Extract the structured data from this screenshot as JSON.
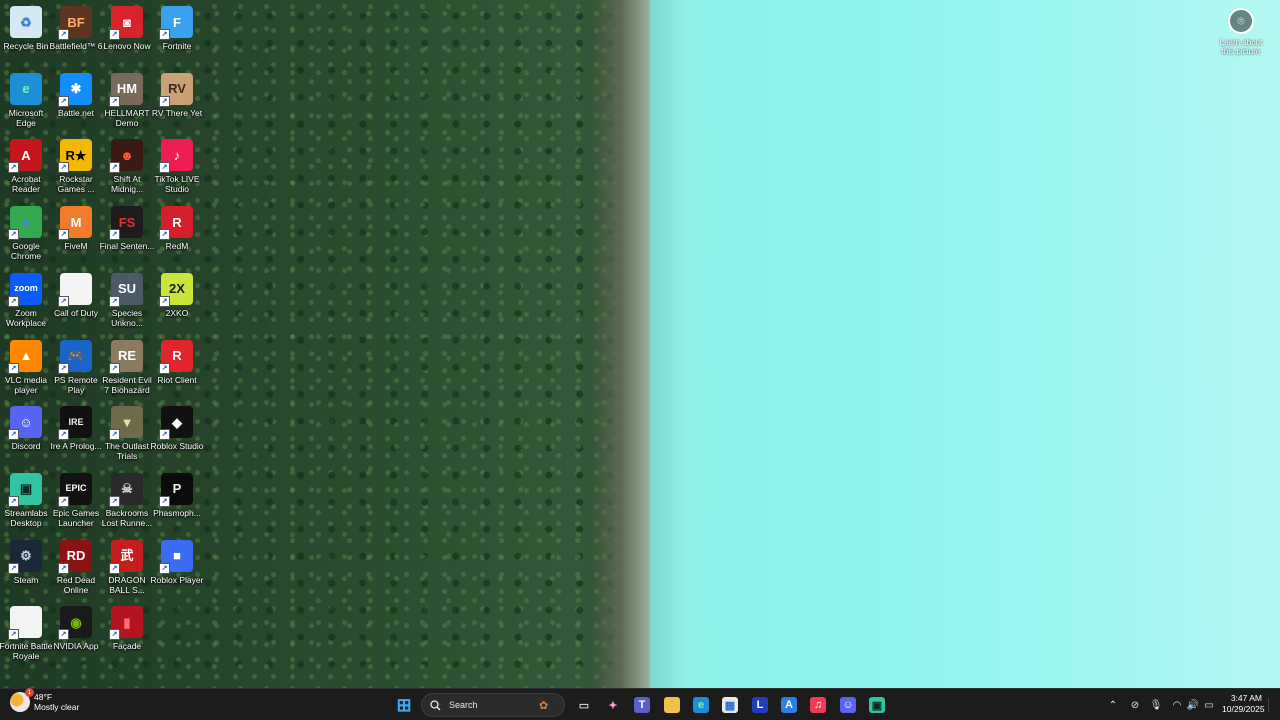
{
  "desktop": {
    "icons": [
      {
        "label": "Recycle Bin",
        "glyph": "♻",
        "color": "#d7e8f5",
        "text_color": "#3a7fd0",
        "icon": "recycle-bin-icon"
      },
      {
        "label": "Battlefield™ 6",
        "glyph": "BF",
        "color": "#5c3521",
        "text_color": "#ffb066",
        "icon": "battlefield-icon"
      },
      {
        "label": "Lenovo Now",
        "glyph": "◙",
        "color": "#d8232a",
        "text_color": "#ffffff",
        "icon": "lenovo-icon"
      },
      {
        "label": "Fortnite",
        "glyph": "F",
        "color": "#3aa0f0",
        "text_color": "#ffffff",
        "icon": "fortnite-icon"
      },
      {
        "label": "Microsoft Edge",
        "glyph": "e",
        "color": "#1d8fd6",
        "text_color": "#7df2a4",
        "icon": "edge-icon"
      },
      {
        "label": "Battle.net",
        "glyph": "✱",
        "color": "#148eff",
        "text_color": "#ffffff",
        "icon": "battlenet-icon"
      },
      {
        "label": "HELLMART Demo",
        "glyph": "HM",
        "color": "#7a6a5a",
        "text_color": "#ffffff",
        "icon": "hellmart-icon"
      },
      {
        "label": "RV There Yet",
        "glyph": "RV",
        "color": "#c9a278",
        "text_color": "#3a2a1a",
        "icon": "rv-there-yet-icon"
      },
      {
        "label": "Acrobat Reader",
        "glyph": "A",
        "color": "#c4161c",
        "text_color": "#ffffff",
        "icon": "acrobat-icon"
      },
      {
        "label": "Rockstar Games ...",
        "glyph": "R★",
        "color": "#f5b800",
        "text_color": "#000000",
        "icon": "rockstar-icon"
      },
      {
        "label": "Shift At Midnig...",
        "glyph": "☻",
        "color": "#3b1a14",
        "text_color": "#ff5a3a",
        "icon": "shift-at-midnight-icon"
      },
      {
        "label": "TikTok LIVE Studio",
        "glyph": "♪",
        "color": "#ee1d52",
        "text_color": "#ffffff",
        "icon": "tiktok-icon"
      },
      {
        "label": "Google Chrome",
        "glyph": "●",
        "color": "#34a853",
        "text_color": "#4285f4",
        "icon": "chrome-icon"
      },
      {
        "label": "FiveM",
        "glyph": "M",
        "color": "#f07b2b",
        "text_color": "#ffffff",
        "icon": "fivem-icon"
      },
      {
        "label": "Final Senten...",
        "glyph": "FS",
        "color": "#1c1c1c",
        "text_color": "#e03030",
        "icon": "final-sentence-icon"
      },
      {
        "label": "RedM",
        "glyph": "R",
        "color": "#d4202a",
        "text_color": "#ffffff",
        "icon": "redm-icon"
      },
      {
        "label": "Zoom Workplace",
        "glyph": "zoom",
        "color": "#0b5cff",
        "text_color": "#ffffff",
        "icon": "zoom-icon"
      },
      {
        "label": "Call of Duty",
        "glyph": "",
        "color": "#f4f4f4",
        "text_color": "#000000",
        "icon": "call-of-duty-icon"
      },
      {
        "label": "Species Unkno...",
        "glyph": "SU",
        "color": "#4a5a66",
        "text_color": "#ffffff",
        "icon": "species-unknown-icon"
      },
      {
        "label": "2XKO",
        "glyph": "2X",
        "color": "#c8e63a",
        "text_color": "#1a1a1a",
        "icon": "2xko-icon"
      },
      {
        "label": "VLC media player",
        "glyph": "▲",
        "color": "#ff8800",
        "text_color": "#ffffff",
        "icon": "vlc-icon"
      },
      {
        "label": "PS Remote Play",
        "glyph": "🎮",
        "color": "#1a63c7",
        "text_color": "#ffffff",
        "icon": "ps-remote-play-icon"
      },
      {
        "label": "Resident Evil 7 Biohazard",
        "glyph": "RE",
        "color": "#8a7a60",
        "text_color": "#ffffff",
        "icon": "resident-evil-icon"
      },
      {
        "label": "Riot Client",
        "glyph": "R",
        "color": "#e0262b",
        "text_color": "#ffffff",
        "icon": "riot-client-icon"
      },
      {
        "label": "Discord",
        "glyph": "☺",
        "color": "#5865f2",
        "text_color": "#ffffff",
        "icon": "discord-icon"
      },
      {
        "label": "Ire A Prolog...",
        "glyph": "IRE",
        "color": "#111111",
        "text_color": "#f0f0f0",
        "icon": "ire-icon"
      },
      {
        "label": "The Outlast Trials",
        "glyph": "▼",
        "color": "#6e6a4a",
        "text_color": "#e6e0b0",
        "icon": "outlast-trials-icon"
      },
      {
        "label": "Roblox Studio",
        "glyph": "◆",
        "color": "#111111",
        "text_color": "#ffffff",
        "icon": "roblox-studio-icon"
      },
      {
        "label": "Streamlabs Desktop",
        "glyph": "▣",
        "color": "#31c3a2",
        "text_color": "#0f2a24",
        "icon": "streamlabs-icon"
      },
      {
        "label": "Epic Games Launcher",
        "glyph": "EPIC",
        "color": "#121212",
        "text_color": "#ffffff",
        "icon": "epic-games-icon"
      },
      {
        "label": "Backrooms Lost Runne...",
        "glyph": "☠",
        "color": "#2a2a2a",
        "text_color": "#d0d0d0",
        "icon": "backrooms-icon"
      },
      {
        "label": "Phasmoph...",
        "glyph": "P",
        "color": "#0c0c0c",
        "text_color": "#f0f0f0",
        "icon": "phasmophobia-icon"
      },
      {
        "label": "Steam",
        "glyph": "⚙",
        "color": "#1b2838",
        "text_color": "#c7d5e0",
        "icon": "steam-icon"
      },
      {
        "label": "Red Dead Online",
        "glyph": "RD",
        "color": "#8a1414",
        "text_color": "#ffffff",
        "icon": "red-dead-online-icon"
      },
      {
        "label": "DRAGON BALL S...",
        "glyph": "武",
        "color": "#c41e1e",
        "text_color": "#ffffff",
        "icon": "dragon-ball-icon"
      },
      {
        "label": "Roblox Player",
        "glyph": "■",
        "color": "#3b6cf5",
        "text_color": "#ffffff",
        "icon": "roblox-player-icon"
      },
      {
        "label": "Fortnite Battle Royale",
        "glyph": "",
        "color": "#f4f4f4",
        "text_color": "#000000",
        "icon": "fortnite-battle-royale-icon"
      },
      {
        "label": "NVIDIA App",
        "glyph": "◉",
        "color": "#1a1a1a",
        "text_color": "#76b900",
        "icon": "nvidia-icon"
      },
      {
        "label": "Façade",
        "glyph": "▮",
        "color": "#b5141e",
        "text_color": "#ff7070",
        "icon": "facade-icon"
      }
    ],
    "learn_about_picture": "Learn about this picture"
  },
  "taskbar": {
    "weather": {
      "temp": "48°F",
      "condition": "Mostly clear",
      "badge": "1"
    },
    "search_placeholder": "Search",
    "apps": [
      {
        "icon": "start-icon",
        "glyph": "⊞",
        "color": "transparent",
        "text_color": "#3fa9f5"
      },
      {
        "icon": "task-view-icon",
        "glyph": "▭",
        "color": "transparent",
        "text_color": "#d0d0d0"
      },
      {
        "icon": "copilot-icon",
        "glyph": "✦",
        "color": "transparent",
        "text_color": "#ff9ad5"
      },
      {
        "icon": "teams-icon",
        "glyph": "T",
        "color": "#5b5fc7",
        "text_color": "#ffffff"
      },
      {
        "icon": "file-explorer-icon",
        "glyph": "▬",
        "color": "#f2c14b",
        "text_color": "#f2c14b"
      },
      {
        "icon": "edge-taskbar-icon",
        "glyph": "e",
        "color": "#1d8fd6",
        "text_color": "#7df2a4"
      },
      {
        "icon": "microsoft-store-icon",
        "glyph": "▦",
        "color": "#e8e8e8",
        "text_color": "#2a6ed6"
      },
      {
        "icon": "lenovo-l-icon",
        "glyph": "L",
        "color": "#1f3fbf",
        "text_color": "#ffffff"
      },
      {
        "icon": "app-installer-icon",
        "glyph": "A",
        "color": "#2f7fe0",
        "text_color": "#ffffff"
      },
      {
        "icon": "music-icon",
        "glyph": "♫",
        "color": "#f03c5a",
        "text_color": "#ffffff"
      },
      {
        "icon": "discord-taskbar-icon",
        "glyph": "☺",
        "color": "#5865f2",
        "text_color": "#ffffff"
      },
      {
        "icon": "streamlabs-taskbar-icon",
        "glyph": "▣",
        "color": "#31c3a2",
        "text_color": "#0f2a24"
      }
    ],
    "tray": [
      {
        "icon": "chevron-up-icon",
        "glyph": "⌃"
      },
      {
        "icon": "camera-off-icon",
        "glyph": "⊘"
      },
      {
        "icon": "microphone-icon",
        "glyph": "🎙"
      },
      {
        "icon": "wifi-icon",
        "glyph": "◠"
      },
      {
        "icon": "volume-icon",
        "glyph": "🔊"
      },
      {
        "icon": "battery-icon",
        "glyph": "▭"
      }
    ],
    "clock": {
      "time": "3:47 AM",
      "date": "10/29/2025"
    }
  }
}
